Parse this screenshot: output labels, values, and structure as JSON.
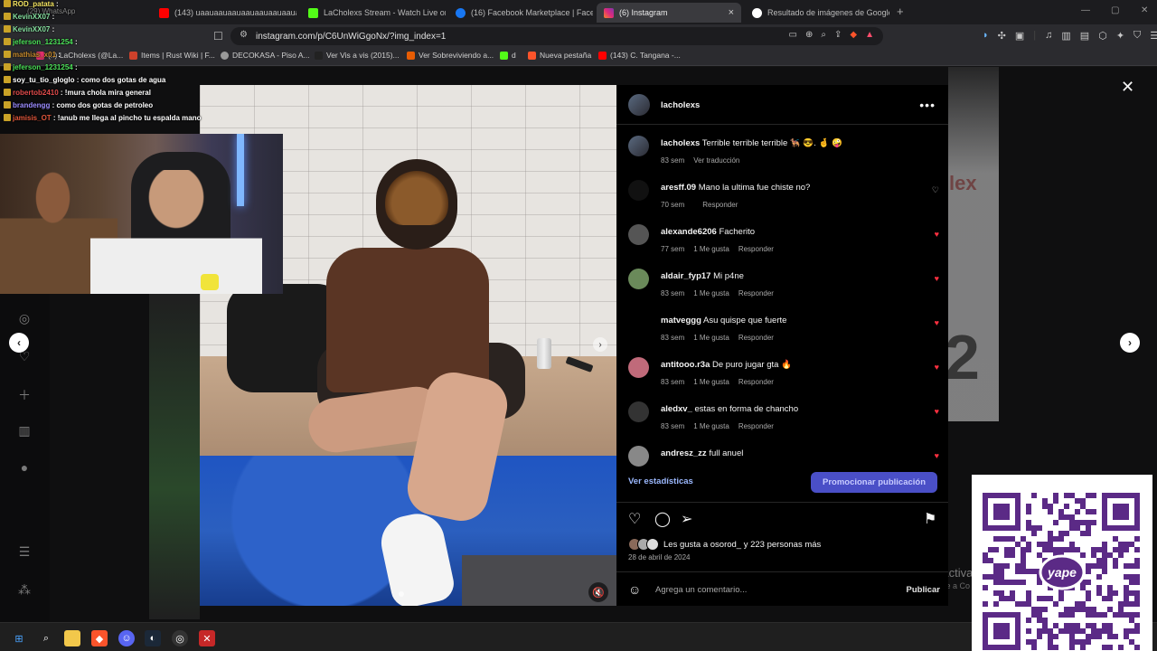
{
  "tabs": [
    {
      "label": "(143) uaauaauaauaauaauaauaauaauaau",
      "color": "#ff0000"
    },
    {
      "label": "LaCholexs Stream - Watch Live on Ki",
      "color": "#53fc18"
    },
    {
      "label": "(16) Facebook Marketplace | Facebo",
      "color": "#1877f2"
    },
    {
      "label": "(6) Instagram",
      "color": "#e1306c"
    },
    {
      "label": "Resultado de imágenes de Google",
      "color": "#4285f4"
    }
  ],
  "active_tab_close": "×",
  "new_tab": "+",
  "address": {
    "url": "instagram.com/p/C6UnWiGgoNx/?img_index=1"
  },
  "bookmarks": [
    {
      "label": "(..) LaCholexs (@La...",
      "color": "#e1306c"
    },
    {
      "label": "Items | Rust Wiki | F...",
      "color": "#cd412b"
    },
    {
      "label": "DECOKASA - Piso A...",
      "color": "#999999"
    },
    {
      "label": "Ver Vis a vis (2015)...",
      "color": "#222222"
    },
    {
      "label": "Ver Sobreviviendo a...",
      "color": "#e85d04"
    },
    {
      "label": "d",
      "color": "#53fc18"
    },
    {
      "label": "Nueva pestaña",
      "color": "#fb542b"
    },
    {
      "label": "(143) C. Tangana -...",
      "color": "#ff0000"
    }
  ],
  "chat": [
    {
      "user": "ROD_patata",
      "text": ":",
      "color": "#f5e663"
    },
    {
      "user": "KevinXX07",
      "text": ":",
      "color": "#86e0a0"
    },
    {
      "user": "KevinXX07",
      "text": ":",
      "color": "#86e0a0"
    },
    {
      "user": "jeferson_1231254",
      "text": ":",
      "color": "#4de25a"
    },
    {
      "user": "mathias_x01",
      "text": ":",
      "color": "#c78b2e"
    },
    {
      "user": "jeferson_1231254",
      "text": ":",
      "color": "#4de25a"
    },
    {
      "user": "soy_tu_tio_gloglo",
      "text": ": como dos gotas de agua",
      "color": "#ffffff"
    },
    {
      "user": "robertob2410",
      "text": ": !mura chola mira general",
      "color": "#e04b4b"
    },
    {
      "user": "brandengg",
      "text": ": como dos gotas de petroleo",
      "color": "#9b8cff"
    },
    {
      "user": "jamisis_OT",
      "text": ": !anub me llega al pincho tu espalda mano",
      "color": "#e0563b"
    }
  ],
  "chat_behind": "(29) WhatsApp",
  "post": {
    "author": "lacholexs",
    "more": "•••",
    "caption_user": "lacholexs",
    "caption": "Terrible terrible terrible 🐕‍🦺 😎. 🤞 🤪",
    "caption_time": "83 sem",
    "caption_translate": "Ver traducción",
    "comments": [
      {
        "user": "aresff.09",
        "text": "Mano la ultima fue chiste no?",
        "time": "70 sem",
        "likes": "",
        "reply": "Responder",
        "liked": false
      },
      {
        "user": "alexande6206",
        "text": "Facherito",
        "time": "77 sem",
        "likes": "1 Me gusta",
        "reply": "Responder",
        "liked": true
      },
      {
        "user": "aldair_fyp17",
        "text": "Mi p4ne",
        "time": "83 sem",
        "likes": "1 Me gusta",
        "reply": "Responder",
        "liked": true
      },
      {
        "user": "matveggg",
        "text": "Asu quispe que fuerte",
        "time": "83 sem",
        "likes": "1 Me gusta",
        "reply": "Responder",
        "liked": true
      },
      {
        "user": "antitooo.r3a",
        "text": "De puro jugar gta 🔥",
        "time": "83 sem",
        "likes": "1 Me gusta",
        "reply": "Responder",
        "liked": true
      },
      {
        "user": "aledxv_",
        "text": "estas en forma de chancho",
        "time": "83 sem",
        "likes": "1 Me gusta",
        "reply": "Responder",
        "liked": true
      },
      {
        "user": "andresz_zz",
        "text": "full anuel",
        "time": "",
        "likes": "",
        "reply": "",
        "liked": true
      }
    ],
    "stats_link": "Ver estadísticas",
    "promote_button": "Promocionar publicación",
    "likes_text": "Les gusta a osorod_ y 223 personas más",
    "date": "28 de abril de 2024",
    "comment_placeholder": "Agrega un comentario...",
    "publish": "Publicar"
  },
  "overlay_text": {
    "line1": "Activa",
    "line2": "Ve a Co"
  },
  "colors": {
    "heart": "#ff3040",
    "link": "#9cb9ff",
    "promote_bg": "#4a4fc7",
    "qr": "#5b2a86"
  }
}
